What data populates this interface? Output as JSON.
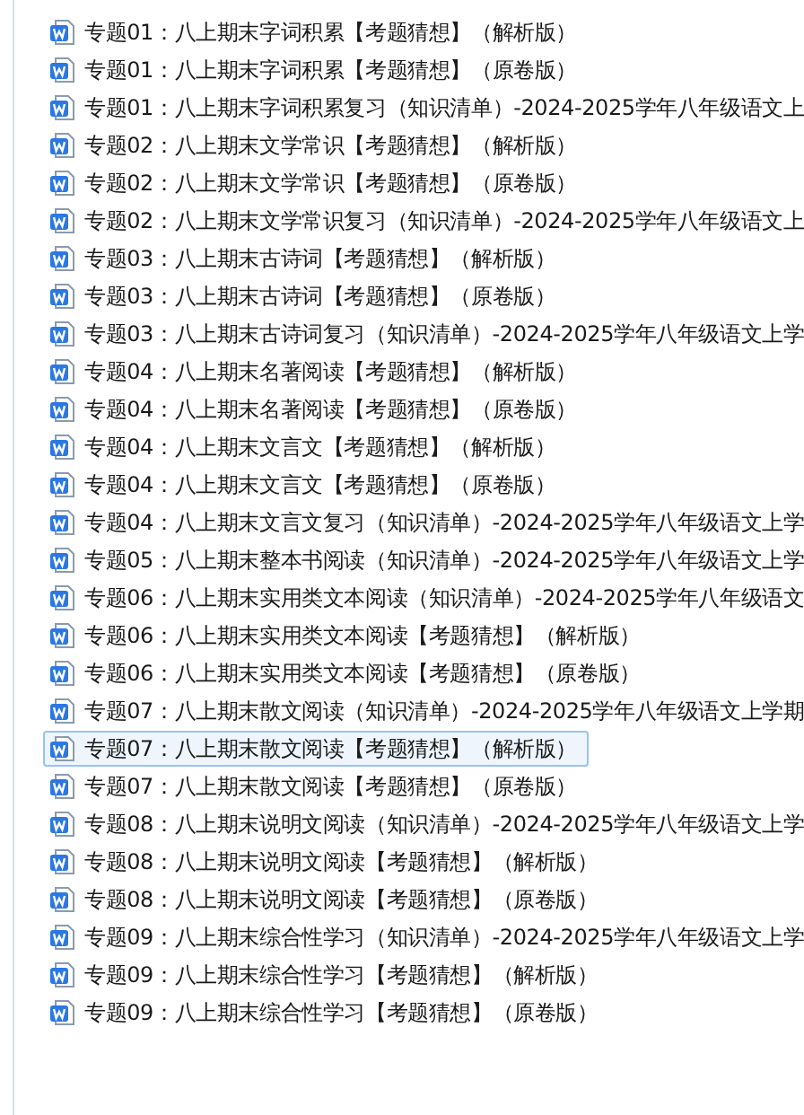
{
  "files": [
    {
      "name": "专题01：八上期末字词积累【考题猜想】（解析版）",
      "selected": false
    },
    {
      "name": "专题01：八上期末字词积累【考题猜想】（原卷版）",
      "selected": false
    },
    {
      "name": "专题01：八上期末字词积累复习（知识清单）-2024-2025学年八年级语文上",
      "selected": false
    },
    {
      "name": "专题02：八上期末文学常识【考题猜想】（解析版）",
      "selected": false
    },
    {
      "name": "专题02：八上期末文学常识【考题猜想】（原卷版）",
      "selected": false
    },
    {
      "name": "专题02：八上期末文学常识复习（知识清单）-2024-2025学年八年级语文上",
      "selected": false
    },
    {
      "name": "专题03：八上期末古诗词【考题猜想】（解析版）",
      "selected": false
    },
    {
      "name": "专题03：八上期末古诗词【考题猜想】（原卷版）",
      "selected": false
    },
    {
      "name": "专题03：八上期末古诗词复习（知识清单）-2024-2025学年八年级语文上学",
      "selected": false
    },
    {
      "name": "专题04：八上期末名著阅读【考题猜想】（解析版）",
      "selected": false
    },
    {
      "name": "专题04：八上期末名著阅读【考题猜想】（原卷版）",
      "selected": false
    },
    {
      "name": "专题04：八上期末文言文【考题猜想】（解析版）",
      "selected": false
    },
    {
      "name": "专题04：八上期末文言文【考题猜想】（原卷版）",
      "selected": false
    },
    {
      "name": "专题04：八上期末文言文复习（知识清单）-2024-2025学年八年级语文上学",
      "selected": false
    },
    {
      "name": "专题05：八上期末整本书阅读（知识清单）-2024-2025学年八年级语文上学",
      "selected": false
    },
    {
      "name": "专题06：八上期末实用类文本阅读（知识清单）-2024-2025学年八年级语文",
      "selected": false
    },
    {
      "name": "专题06：八上期末实用类文本阅读【考题猜想】（解析版）",
      "selected": false
    },
    {
      "name": "专题06：八上期末实用类文本阅读【考题猜想】（原卷版）",
      "selected": false
    },
    {
      "name": "专题07：八上期末散文阅读（知识清单）-2024-2025学年八年级语文上学期",
      "selected": false
    },
    {
      "name": "专题07：八上期末散文阅读【考题猜想】（解析版）",
      "selected": true
    },
    {
      "name": "专题07：八上期末散文阅读【考题猜想】（原卷版）",
      "selected": false
    },
    {
      "name": "专题08：八上期末说明文阅读（知识清单）-2024-2025学年八年级语文上学",
      "selected": false
    },
    {
      "name": "专题08：八上期末说明文阅读【考题猜想】（解析版）",
      "selected": false
    },
    {
      "name": "专题08：八上期末说明文阅读【考题猜想】（原卷版）",
      "selected": false
    },
    {
      "name": "专题09：八上期末综合性学习（知识清单）-2024-2025学年八年级语文上学",
      "selected": false
    },
    {
      "name": "专题09：八上期末综合性学习【考题猜想】（解析版）",
      "selected": false
    },
    {
      "name": "专题09：八上期末综合性学习【考题猜想】（原卷版）",
      "selected": false
    }
  ]
}
